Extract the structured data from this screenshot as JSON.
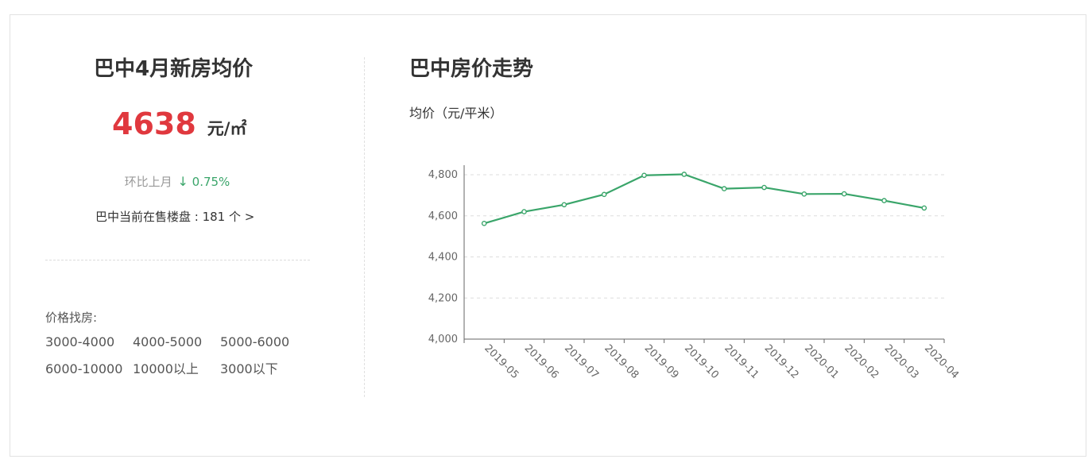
{
  "left": {
    "title": "巴中4月新房均价",
    "price": "4638",
    "unit": "元/㎡",
    "mom_label": "环比上月",
    "mom_arrow": "↓",
    "mom_value": "0.75%",
    "onsale_text": "巴中当前在售楼盘 : 181 个 >",
    "filter_title": "价格找房:",
    "ranges": [
      "3000-4000",
      "4000-5000",
      "5000-6000",
      "6000-10000",
      "10000以上",
      "3000以下"
    ]
  },
  "right": {
    "title": "巴中房价走势",
    "y_unit": "均价（元/平米）"
  },
  "colors": {
    "price": "#e0383e",
    "line": "#3aa56a",
    "grid": "#dddddd"
  },
  "chart_data": {
    "type": "line",
    "title": "",
    "xlabel": "",
    "ylabel": "均价（元/平米）",
    "ylim": [
      4000,
      4800
    ],
    "yticks": [
      4000,
      4200,
      4400,
      4600,
      4800
    ],
    "ytick_labels": [
      "4,000",
      "4,200",
      "4,400",
      "4,600",
      "4,800"
    ],
    "grid": true,
    "legend": "none",
    "categories": [
      "2019-05",
      "2019-06",
      "2019-07",
      "2019-08",
      "2019-09",
      "2019-10",
      "2019-11",
      "2019-12",
      "2020-01",
      "2020-02",
      "2020-03",
      "2020-04"
    ],
    "series": [
      {
        "values": [
          4563,
          4620,
          4654,
          4704,
          4797,
          4802,
          4732,
          4738,
          4706,
          4707,
          4674,
          4638
        ]
      }
    ]
  }
}
